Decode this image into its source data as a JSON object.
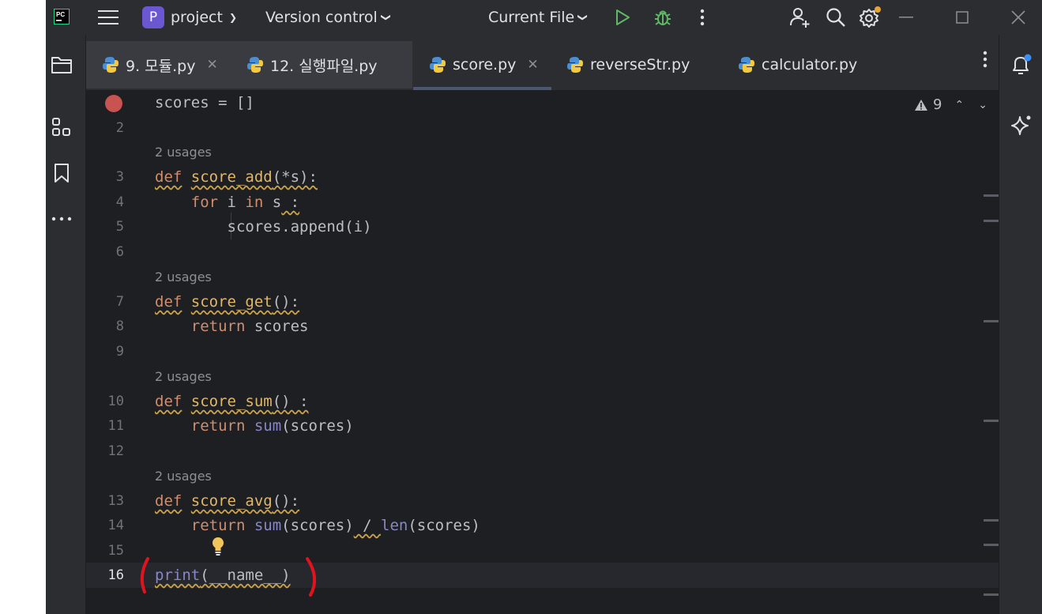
{
  "titlebar": {
    "project_badge": "P",
    "project_name": "project",
    "version_control": "Version control",
    "run_config": "Current File",
    "icons": [
      "pycharm-logo-icon",
      "hamburger-menu-icon",
      "chevron-down-icon",
      "run-icon",
      "debug-icon",
      "more-vertical-icon",
      "add-user-icon",
      "search-icon",
      "settings-icon",
      "minimize-icon",
      "maximize-icon",
      "close-icon"
    ]
  },
  "tabs": [
    {
      "label": "9. 모듈.py",
      "closable": true
    },
    {
      "label": "12. 실행파일.py",
      "closable": false
    },
    {
      "label": "score.py",
      "closable": true,
      "active": true
    },
    {
      "label": "reverseStr.py",
      "closable": false
    },
    {
      "label": "calculator.py",
      "closable": false
    }
  ],
  "inspections": {
    "warning_count": "9"
  },
  "editor": {
    "line_numbers": [
      "2",
      "3",
      "4",
      "5",
      "6",
      "7",
      "8",
      "9",
      "10",
      "11",
      "12",
      "13",
      "14",
      "15",
      "16"
    ],
    "usage_hints": [
      "2 usages",
      "2 usages",
      "2 usages",
      "2 usages"
    ],
    "lines": {
      "l1": "scores = []",
      "l3_kw": "def",
      "l3_name": "score_add",
      "l3_rest": "(*s):",
      "l4_a": "for",
      "l4_b": " i ",
      "l4_c": "in",
      "l4_d": " s",
      "l4_e": " :",
      "l5": "scores.append(i)",
      "l7_kw": "def",
      "l7_name": "score_get",
      "l7_rest": "():",
      "l8_kw": "return",
      "l8_rest": " scores",
      "l10_kw": "def",
      "l10_name": "score_sum",
      "l10_rest": "() :",
      "l11_kw": "return",
      "l11_fn": " sum",
      "l11_rest": "(scores)",
      "l13_kw": "def",
      "l13_name": "score_avg",
      "l13_rest": "():",
      "l14_kw": "return",
      "l14_fn": " sum",
      "l14_a": "(scores)",
      "l14_b": " / ",
      "l14_fn2": "len",
      "l14_c": "(scores)",
      "l16_fn": "print",
      "l16_rest": "(__name__)"
    }
  },
  "colors": {
    "background": "#2b2d30",
    "editor": "#1e1f22",
    "keyword": "#cf8e6d",
    "function_name": "#e0b76b",
    "builtin": "#8888c6",
    "annotation_red": "#e0141e"
  }
}
